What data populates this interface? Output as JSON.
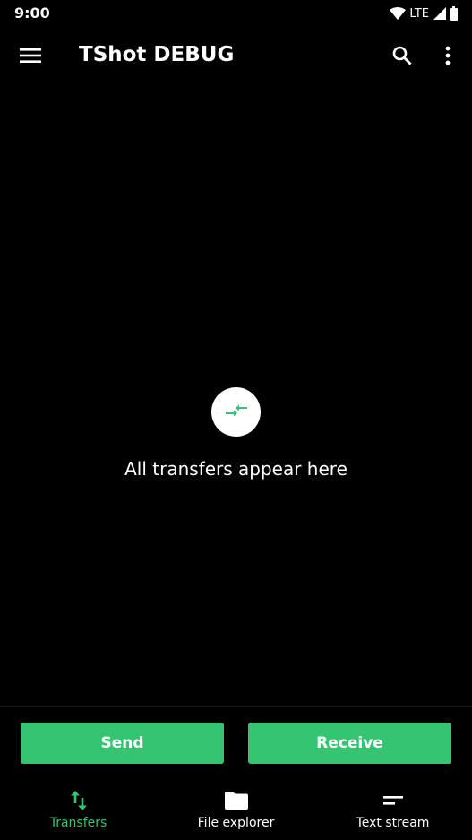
{
  "status_bar": {
    "time": "9:00",
    "network": "LTE"
  },
  "app_bar": {
    "title": "TShot DEBUG"
  },
  "empty_state": {
    "message": "All transfers appear here"
  },
  "actions": {
    "send_label": "Send",
    "receive_label": "Receive"
  },
  "bottom_nav": {
    "items": [
      {
        "label": "Transfers",
        "icon": "swap-vertical-icon",
        "active": true
      },
      {
        "label": "File explorer",
        "icon": "folder-icon",
        "active": false
      },
      {
        "label": "Text stream",
        "icon": "short-text-icon",
        "active": false
      }
    ]
  },
  "colors": {
    "accent": "#34c472",
    "background": "#000000",
    "text": "#ffffff"
  }
}
